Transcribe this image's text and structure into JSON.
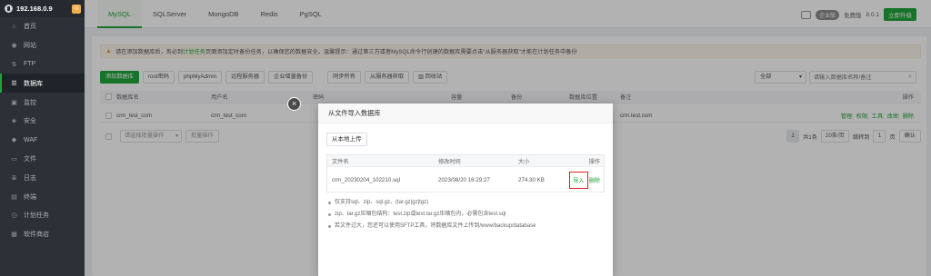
{
  "sidebar": {
    "ip": "192.168.0.9",
    "badge": "0",
    "items": [
      {
        "label": "首页",
        "icon": "home-icon",
        "glyph": "⌂"
      },
      {
        "label": "网站",
        "icon": "globe-icon",
        "glyph": "◉"
      },
      {
        "label": "FTP",
        "icon": "ftp-icon",
        "glyph": "⇅"
      },
      {
        "label": "数据库",
        "icon": "database-icon",
        "glyph": "☰"
      },
      {
        "label": "监控",
        "icon": "monitor-icon",
        "glyph": "▣"
      },
      {
        "label": "安全",
        "icon": "shield-icon",
        "glyph": "◈"
      },
      {
        "label": "WAF",
        "icon": "waf-icon",
        "glyph": "◆"
      },
      {
        "label": "文件",
        "icon": "folder-icon",
        "glyph": "▭"
      },
      {
        "label": "日志",
        "icon": "log-icon",
        "glyph": "≣"
      },
      {
        "label": "终端",
        "icon": "terminal-icon",
        "glyph": "▤"
      },
      {
        "label": "计划任务",
        "icon": "schedule-icon",
        "glyph": "◷"
      },
      {
        "label": "软件商店",
        "icon": "store-icon",
        "glyph": "▦"
      }
    ],
    "active_index": 3
  },
  "topbar": {
    "tabs": [
      "MySQL",
      "SQLServer",
      "MongoDB",
      "Redis",
      "PgSQL"
    ],
    "active_tab": 0,
    "vip_badge": "企业版",
    "edition": "免费版",
    "version": "8.0.1",
    "upgrade": "立即升级"
  },
  "warning": {
    "prefix": "请在添加数据库后，务必到",
    "link": "计划任务",
    "suffix": "页面添加定时备份任务，以确保您的数据安全。温馨提示：通过第三方或者MySQL命令行创建的数据库需要点击\"从服务器获取\"才能在计划任务中备份"
  },
  "toolbar": {
    "add_db": "添加数据库",
    "root_pw": "root密码",
    "phpmyadmin": "phpMyAdmin",
    "remote_server": "远程服务器",
    "enterprise_backup": "企业增量备份",
    "sync_all": "同步所有",
    "fetch_server": "从服务器获取",
    "recycle": "回收站",
    "filter": "全部",
    "search_placeholder": "请输入数据库名称/备注"
  },
  "table": {
    "headers": {
      "name": "数据库名",
      "user": "用户名",
      "password": "密码",
      "capacity": "容量",
      "backup": "备份",
      "location": "数据库位置",
      "note": "备注",
      "action": "操作"
    },
    "rows": [
      {
        "name": "crm_test_com",
        "user": "crm_test_com",
        "note": "crm.test.com",
        "actions": [
          "管理",
          "权限",
          "工具",
          "改密",
          "删除"
        ]
      }
    ]
  },
  "footer": {
    "bulk_placeholder": "请选择批量操作",
    "bulk_btn": "批量操作",
    "page": "1",
    "total": "共1条",
    "page_size": "20条/页",
    "jump_label": "跳转到",
    "jump_value": "1",
    "page_unit": "页",
    "confirm": "确认"
  },
  "modal": {
    "title": "从文件导入数据库",
    "upload": "从本地上传",
    "headers": {
      "file": "文件名",
      "mtime": "修改时间",
      "size": "大小",
      "action": "操作"
    },
    "files": [
      {
        "name": "crm_20230204_102210.sql",
        "mtime": "2023/08/20 16:29:27",
        "size": "274.30 KB",
        "import": "导入",
        "delete": "删除"
      }
    ],
    "notes": [
      "仅支持sql、zip、sql.gz、(tar.gz|gz|tgz)",
      "zip、tar.gz压缩包结构：test.zip或test.tar.gz压缩包内，必需包含test.sql",
      "若文件过大，您还可以使用SFTP工具，将数据库文件上传到/www/backup/database"
    ]
  }
}
